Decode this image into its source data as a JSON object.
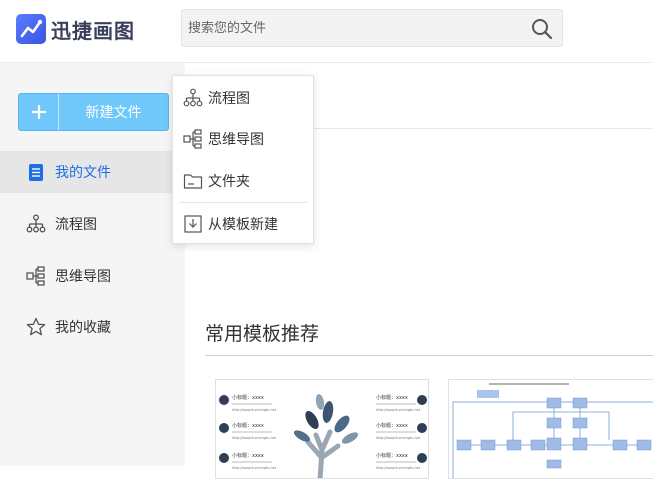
{
  "app": {
    "name": "迅捷画图"
  },
  "search": {
    "placeholder": "搜索您的文件"
  },
  "sidebar": {
    "new_button": "新建文件",
    "items": [
      {
        "label": "我的文件",
        "icon": "document-icon",
        "active": true
      },
      {
        "label": "流程图",
        "icon": "flowchart-icon"
      },
      {
        "label": "思维导图",
        "icon": "mindmap-icon"
      },
      {
        "label": "我的收藏",
        "icon": "star-icon"
      }
    ]
  },
  "dropdown": {
    "items": [
      {
        "label": "流程图",
        "icon": "flowchart-icon"
      },
      {
        "label": "思维导图",
        "icon": "mindmap-icon"
      },
      {
        "label": "文件夹",
        "icon": "folder-icon"
      },
      {
        "label": "从模板新建",
        "icon": "template-import-icon"
      }
    ]
  },
  "main": {
    "section_title": "常用模板推荐",
    "templates": [
      {
        "subtitle": "小标题：xxxx",
        "url": "http://www.liuchengtu.net"
      },
      {
        "caption": ""
      }
    ]
  },
  "colors": {
    "accent": "#1d6fe8",
    "new_button": "#6fc8f9",
    "sidebar_bg": "#f5f5f5"
  }
}
